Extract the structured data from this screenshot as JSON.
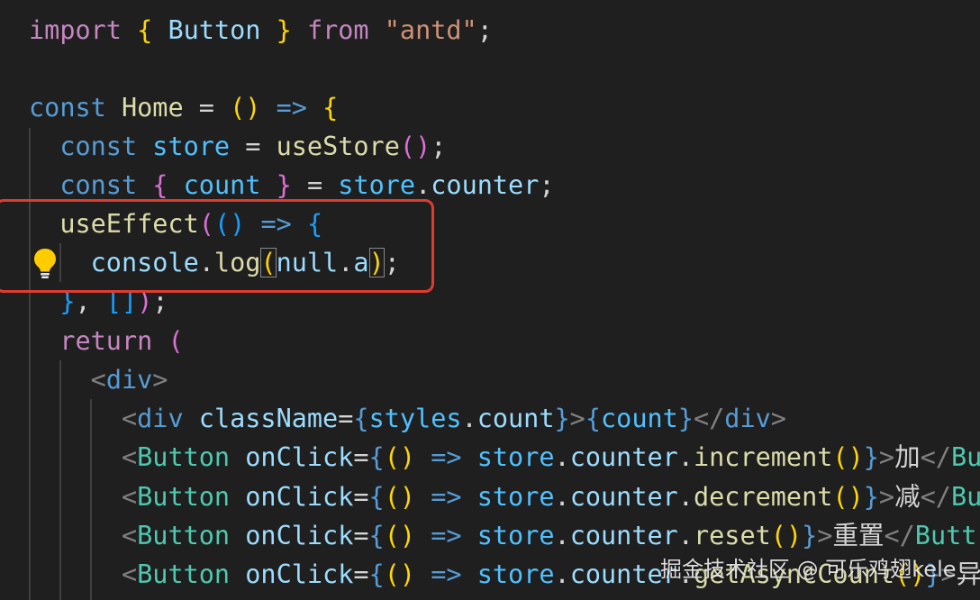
{
  "code_lines": [
    [
      "import",
      "{",
      "Button",
      "}",
      "from",
      "\"antd\"",
      ";"
    ],
    [],
    [
      "const",
      "Home",
      "=",
      "(",
      ")",
      "=>",
      "{"
    ],
    [
      "const",
      "store",
      "=",
      "useStore",
      "(",
      ")",
      ";"
    ],
    [
      "const",
      "{",
      "count",
      "}",
      "=",
      "store",
      ".",
      "counter",
      ";"
    ],
    [
      "useEffect",
      "(",
      "(",
      ")",
      "=>",
      "{"
    ],
    [
      "console",
      ".",
      "log",
      "(",
      "null",
      ".",
      "a",
      ")",
      ";"
    ],
    [
      "}",
      ",",
      "[",
      "]",
      ")",
      ";"
    ],
    [
      "return",
      "("
    ],
    [
      "<",
      "div",
      ">"
    ],
    [
      "<",
      "div",
      "className",
      "=",
      "{",
      "styles",
      ".",
      "count",
      "}",
      ">",
      "{",
      "count",
      "}",
      "</",
      "div",
      ">"
    ],
    [
      "<",
      "Button",
      "onClick",
      "=",
      "{",
      "(",
      ")",
      "=>",
      "store",
      ".",
      "counter",
      ".",
      "increment",
      "(",
      ")",
      "}",
      ">",
      "加",
      "</",
      "Bu"
    ],
    [
      "<",
      "Button",
      "onClick",
      "=",
      "{",
      "(",
      ")",
      "=>",
      "store",
      ".",
      "counter",
      ".",
      "decrement",
      "(",
      ")",
      "}",
      ">",
      "减",
      "</",
      "Bu"
    ],
    [
      "<",
      "Button",
      "onClick",
      "=",
      "{",
      "(",
      ")",
      "=>",
      "store",
      ".",
      "counter",
      ".",
      "reset",
      "(",
      ")",
      "}",
      ">",
      "重置",
      "</",
      "Butt"
    ],
    [
      "<",
      "Button",
      "onClick",
      "=",
      "{",
      "(",
      ")",
      "=>",
      "store",
      ".",
      "counter",
      ".",
      "getAsyncCount",
      "(",
      ")",
      "}",
      ">",
      "异"
    ]
  ],
  "watermark": "掘金技术社区 @ 可乐鸡翅kele",
  "colors": {
    "background": "#1f1f1f",
    "highlight_box": "#e03c2e",
    "lightbulb": "#ffcc00"
  },
  "icons": {
    "lightbulb": "lightbulb-icon"
  }
}
